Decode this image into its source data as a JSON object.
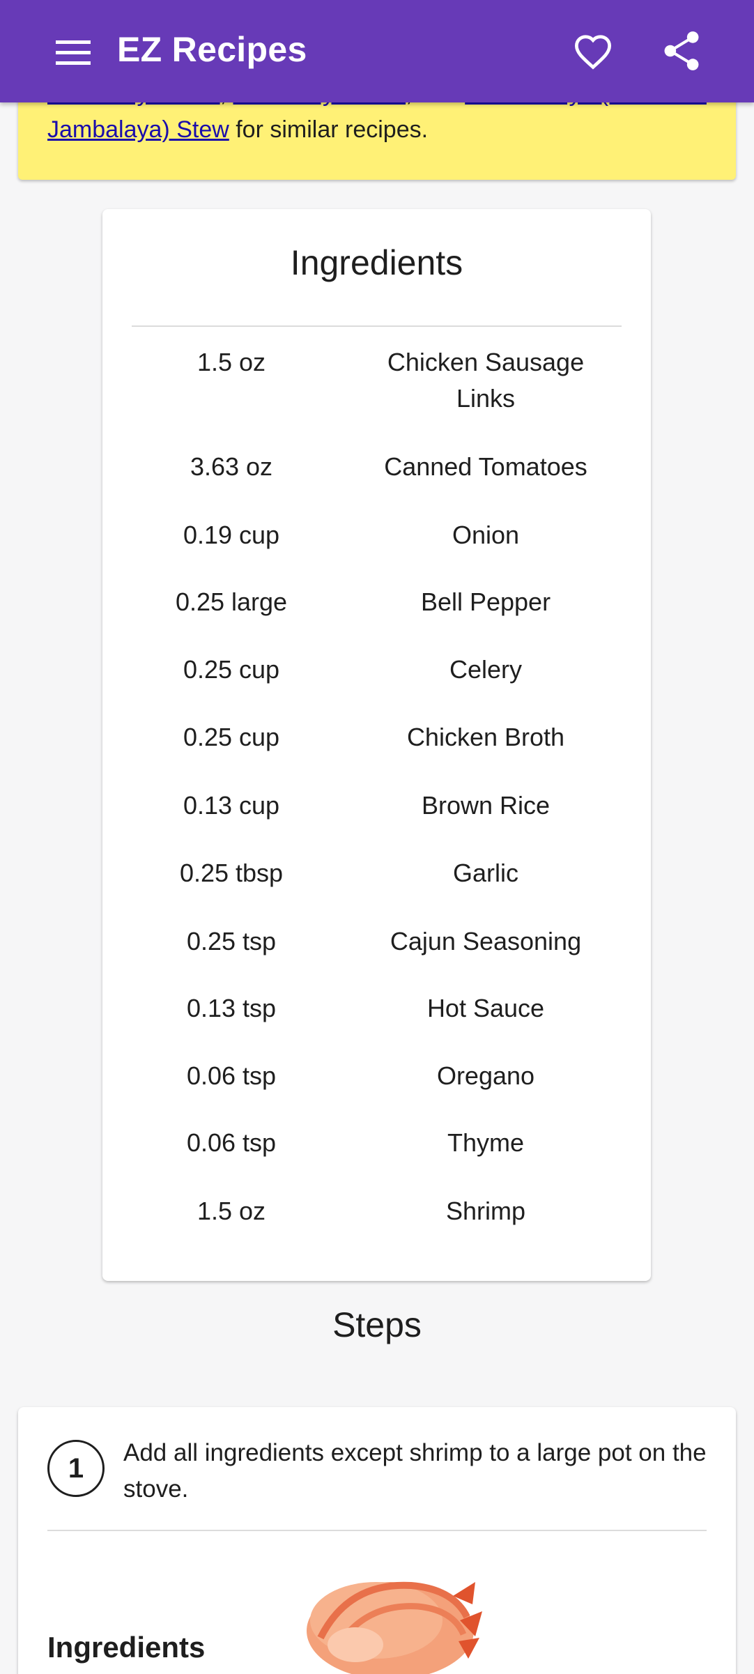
{
  "app": {
    "title": "EZ Recipes",
    "accent_color": "#673ab7",
    "icons": {
      "menu": "hamburger-menu-icon",
      "favorite": "heart-outline-icon",
      "share": "share-icon"
    }
  },
  "notice": {
    "link_1": "Jambalaya Stew",
    "sep_1": ", ",
    "link_2": "Jambalaya Stew",
    "sep_2": ", and ",
    "link_3": "Gumbo-laya (Gumbo + Jambalaya) Stew",
    "tail": " for similar recipes.",
    "background": "#fff176"
  },
  "ingredients": {
    "title": "Ingredients",
    "items": [
      {
        "qty": "1.5 oz",
        "name": "Chicken Sausage Links"
      },
      {
        "qty": "3.63 oz",
        "name": "Canned Tomatoes"
      },
      {
        "qty": "0.19 cup",
        "name": "Onion"
      },
      {
        "qty": "0.25 large",
        "name": "Bell Pepper"
      },
      {
        "qty": "0.25 cup",
        "name": "Celery"
      },
      {
        "qty": "0.25 cup",
        "name": "Chicken Broth"
      },
      {
        "qty": "0.13 cup",
        "name": "Brown Rice"
      },
      {
        "qty": "0.25 tbsp",
        "name": "Garlic"
      },
      {
        "qty": "0.25 tsp",
        "name": "Cajun Seasoning"
      },
      {
        "qty": "0.13 tsp",
        "name": "Hot Sauce"
      },
      {
        "qty": "0.06 tsp",
        "name": "Oregano"
      },
      {
        "qty": "0.06 tsp",
        "name": "Thyme"
      },
      {
        "qty": "1.5 oz",
        "name": "Shrimp"
      }
    ]
  },
  "steps": {
    "heading": "Steps",
    "items": [
      {
        "number": "1",
        "text": "Add all ingredients except shrimp to a large pot on the stove.",
        "ingredients_label": "Ingredients"
      }
    ]
  }
}
